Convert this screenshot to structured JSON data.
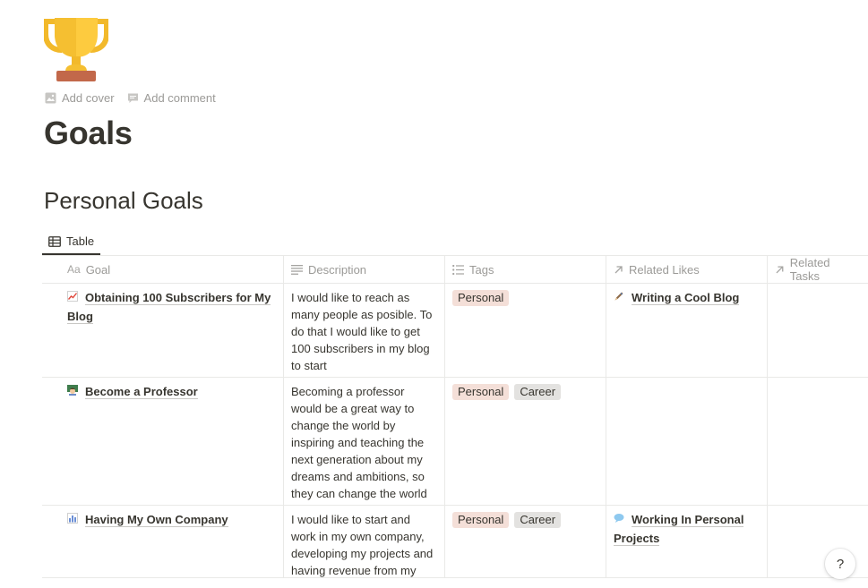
{
  "page": {
    "icon": "trophy-icon",
    "actions": [
      {
        "icon": "image-icon",
        "label": "Add cover"
      },
      {
        "icon": "comment-icon",
        "label": "Add comment"
      }
    ],
    "title": "Goals"
  },
  "database": {
    "title": "Personal Goals",
    "view_tab": {
      "icon": "table-icon",
      "label": "Table"
    },
    "columns": [
      {
        "icon": "text-aa-icon",
        "icon_text": "Aa",
        "label": "Goal"
      },
      {
        "icon": "lines-icon",
        "label": "Description"
      },
      {
        "icon": "list-icon",
        "label": "Tags"
      },
      {
        "icon": "arrow-up-right-icon",
        "label": "Related Likes"
      },
      {
        "icon": "arrow-up-right-icon",
        "label": "Related Tasks"
      }
    ],
    "rows": [
      {
        "goal": "Obtaining 100 Subscribers for My Blog",
        "goal_icon": "chart-increasing-icon",
        "description": "I would like to reach as many people as posible. To do that I would like to get 100 subscribers in my blog to start",
        "tags": [
          "Personal"
        ],
        "related_like": "Writing a Cool Blog",
        "related_like_icon": "pen-icon",
        "related_task": ""
      },
      {
        "goal": "Become a Professor",
        "goal_icon": "teacher-icon",
        "description": "Becoming a professor would be a great way to change the world by inspiring and teaching the next generation about my dreams and ambitions, so they can change the world with me",
        "tags": [
          "Personal",
          "Career"
        ],
        "related_like": "",
        "related_like_icon": "",
        "related_task": ""
      },
      {
        "goal": "Having My Own Company",
        "goal_icon": "bar-chart-icon",
        "description": "I would like to start and work in my own company, developing my projects and having revenue from my",
        "tags": [
          "Personal",
          "Career"
        ],
        "related_like": "Working In Personal Projects",
        "related_like_icon": "speech-bubble-icon",
        "related_task": ""
      }
    ]
  },
  "help_button": {
    "label": "?"
  },
  "colors": {
    "tag_personal": "#f4dfd8",
    "tag_career": "#e3e2e0",
    "text": "#37352f",
    "muted": "#9b9a97",
    "border": "#e9e9e7"
  }
}
